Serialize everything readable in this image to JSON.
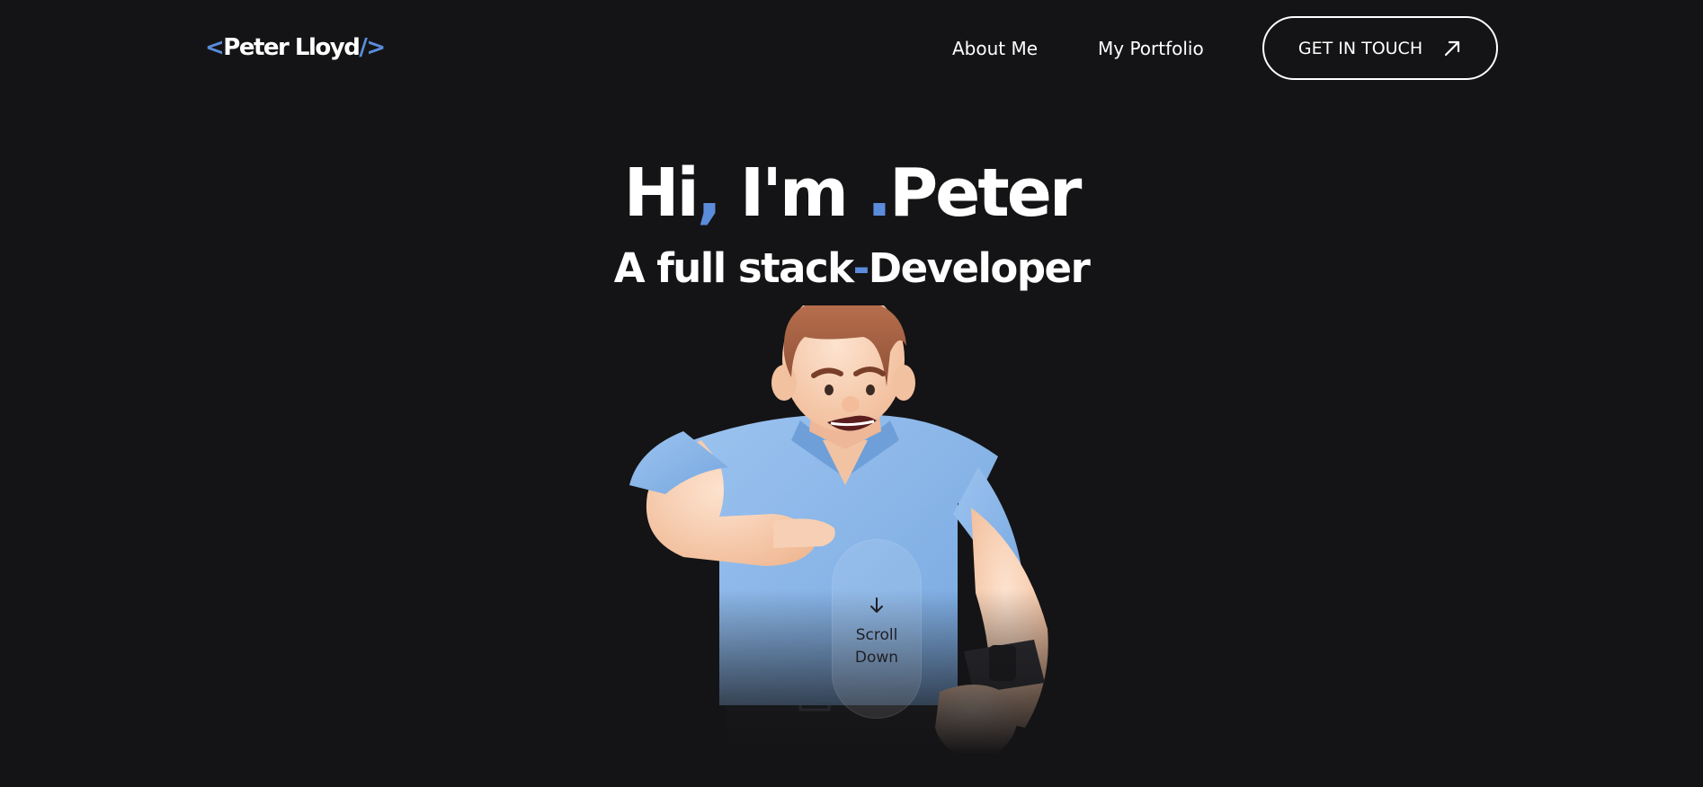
{
  "header": {
    "logo": {
      "open": "<",
      "name": "Peter Lloyd",
      "close": "/>"
    },
    "nav": [
      {
        "label": "About Me"
      },
      {
        "label": "My Portfolio"
      }
    ],
    "cta": {
      "label": "GET IN TOUCH",
      "icon": "arrow-up-right-icon"
    }
  },
  "hero": {
    "title": {
      "part1": "Hi",
      "comma": ",",
      "part2": " I'm ",
      "dot": ".",
      "name": "Peter"
    },
    "subtitle": {
      "part1": "A full stack",
      "dash": "-",
      "part2": "Developer"
    }
  },
  "scroll_indicator": {
    "icon": "arrow-down-icon",
    "line1": "Scroll",
    "line2": "Down"
  },
  "colors": {
    "background": "#141416",
    "accent": "#5b8cdb",
    "text": "#ffffff",
    "shirt": "#87b4e8"
  }
}
